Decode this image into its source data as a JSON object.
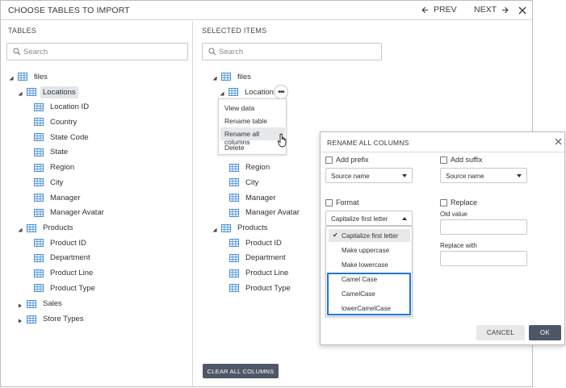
{
  "header": {
    "title": "CHOOSE TABLES TO IMPORT",
    "prev_label": "PREV",
    "next_label": "NEXT"
  },
  "left_panel": {
    "section_label": "TABLES",
    "search_placeholder": "Search",
    "root": "files",
    "locations": {
      "label": "Locations",
      "columns": [
        "Location ID",
        "Country",
        "State Code",
        "State",
        "Region",
        "City",
        "Manager",
        "Manager Avatar"
      ]
    },
    "products": {
      "label": "Products",
      "columns": [
        "Product ID",
        "Department",
        "Product Line",
        "Product Type"
      ]
    },
    "sales": "Sales",
    "store_types": "Store Types"
  },
  "right_panel": {
    "section_label": "SELECTED ITEMS",
    "search_placeholder": "Search",
    "root": "files",
    "locations": {
      "label": "Locations",
      "columns": [
        "Region",
        "City",
        "Manager",
        "Manager Avatar"
      ]
    },
    "products": {
      "label": "Products",
      "columns": [
        "Product ID",
        "Department",
        "Product Line",
        "Product Type"
      ]
    },
    "more_label": "•••",
    "clear_label": "CLEAR ALL COLUMNS"
  },
  "context_menu": {
    "items": [
      "View data",
      "Rename table",
      "Rename all columns",
      "Delete"
    ]
  },
  "dialog": {
    "title": "RENAME ALL COLUMNS",
    "add_prefix": "Add prefix",
    "prefix_select": "Source name",
    "add_suffix": "Add suffix",
    "suffix_select": "Source name",
    "format": "Format",
    "format_select": "Capitalize first letter",
    "replace": "Replace",
    "old_value": "Old value",
    "replace_with": "Replace with",
    "cancel": "CANCEL",
    "ok": "OK"
  },
  "format_options": [
    "Capitalize first letter",
    "Make uppercase",
    "Make lowercase",
    "Camel Case",
    "CamelCase",
    "lowerCamelCase"
  ],
  "colors": {
    "primary_button": "#4e5766",
    "highlight": "#1e77d3",
    "table_icon": "#4a90d9"
  }
}
